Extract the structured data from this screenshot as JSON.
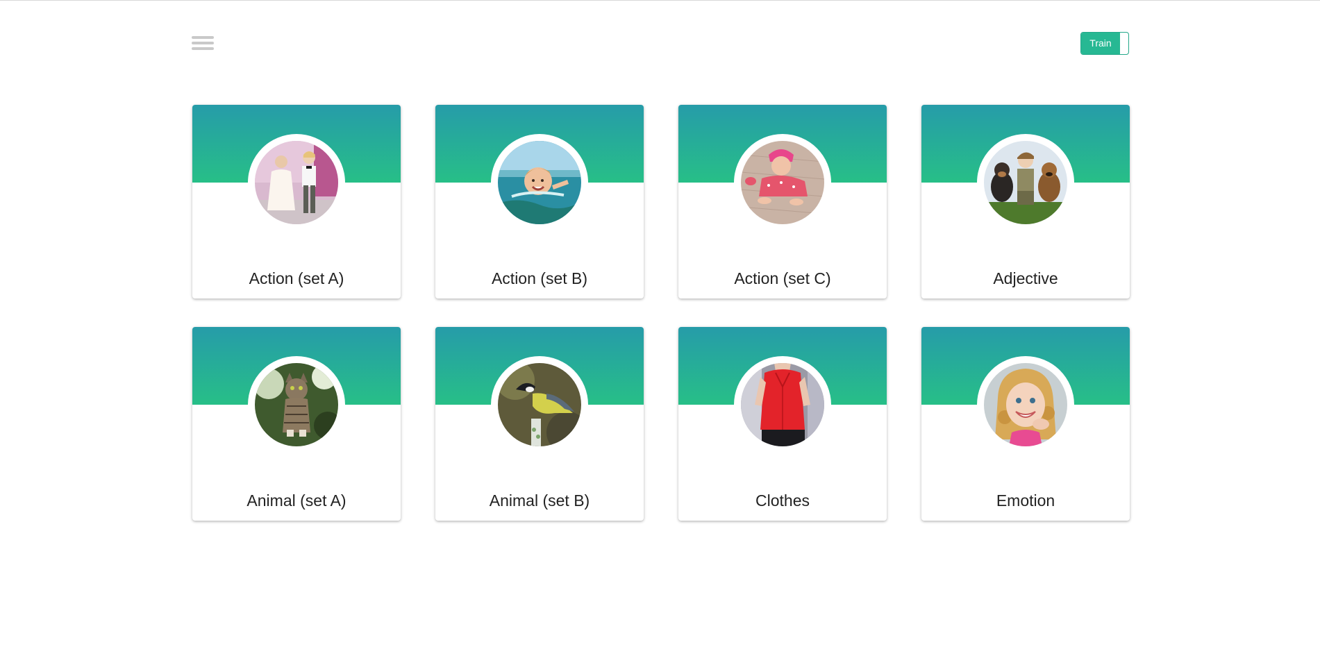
{
  "header": {
    "menu_icon": "hamburger-menu-icon",
    "mode_toggle_label": "Train"
  },
  "colors": {
    "banner_top": "#269ca9",
    "banner_bottom": "#27bf87",
    "toggle": "#27b893"
  },
  "categories": [
    {
      "label": "Action (set A)",
      "image": "two children dancing"
    },
    {
      "label": "Action (set B)",
      "image": "boy swimming in sea"
    },
    {
      "label": "Action (set C)",
      "image": "baby crawling"
    },
    {
      "label": "Adjective",
      "image": "boy with two dogs"
    },
    {
      "label": "Animal (set A)",
      "image": "tabby cat"
    },
    {
      "label": "Animal (set B)",
      "image": "great tit bird"
    },
    {
      "label": "Clothes",
      "image": "red sleeveless blouse"
    },
    {
      "label": "Emotion",
      "image": "smiling girl"
    }
  ]
}
